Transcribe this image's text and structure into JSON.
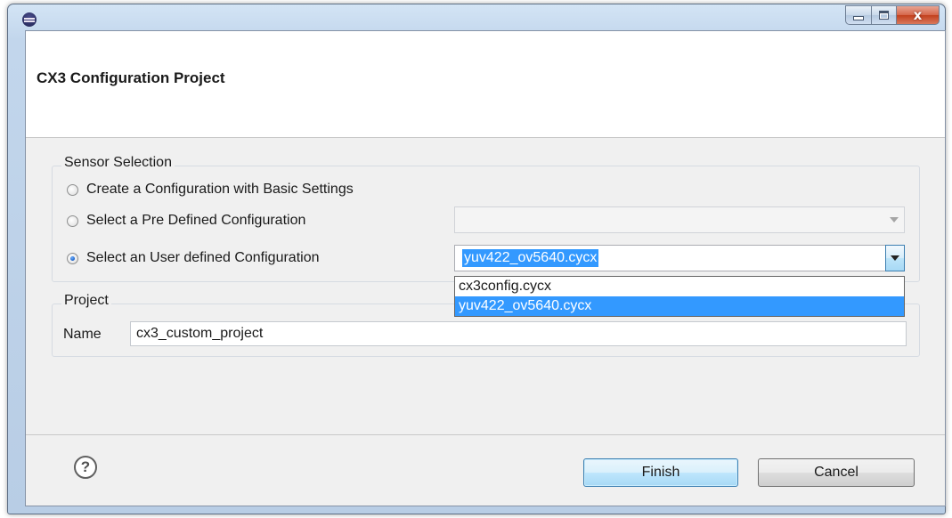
{
  "window": {
    "title": "",
    "controls": {
      "minimize": "minimize",
      "maximize": "maximize",
      "close": "x"
    }
  },
  "header": {
    "title": "CX3 Configuration Project"
  },
  "sensor_selection": {
    "group_title": "Sensor Selection",
    "options": [
      {
        "label": "Create a Configuration with Basic Settings",
        "checked": false
      },
      {
        "label": "Select a Pre Defined Configuration",
        "checked": false
      },
      {
        "label": "Select an User defined Configuration",
        "checked": true
      }
    ],
    "predefined_combo_value": "",
    "user_combo_value": "yuv422_ov5640.cycx",
    "dropdown_options": [
      "cx3config.cycx",
      "yuv422_ov5640.cycx"
    ],
    "dropdown_selected_index": 1
  },
  "project": {
    "group_title": "Project",
    "name_label": "Name",
    "name_value": "cx3_custom_project"
  },
  "footer": {
    "help_glyph": "?",
    "finish_label": "Finish",
    "cancel_label": "Cancel"
  },
  "icons": {
    "app": "eclipse-icon",
    "help": "help-icon"
  }
}
